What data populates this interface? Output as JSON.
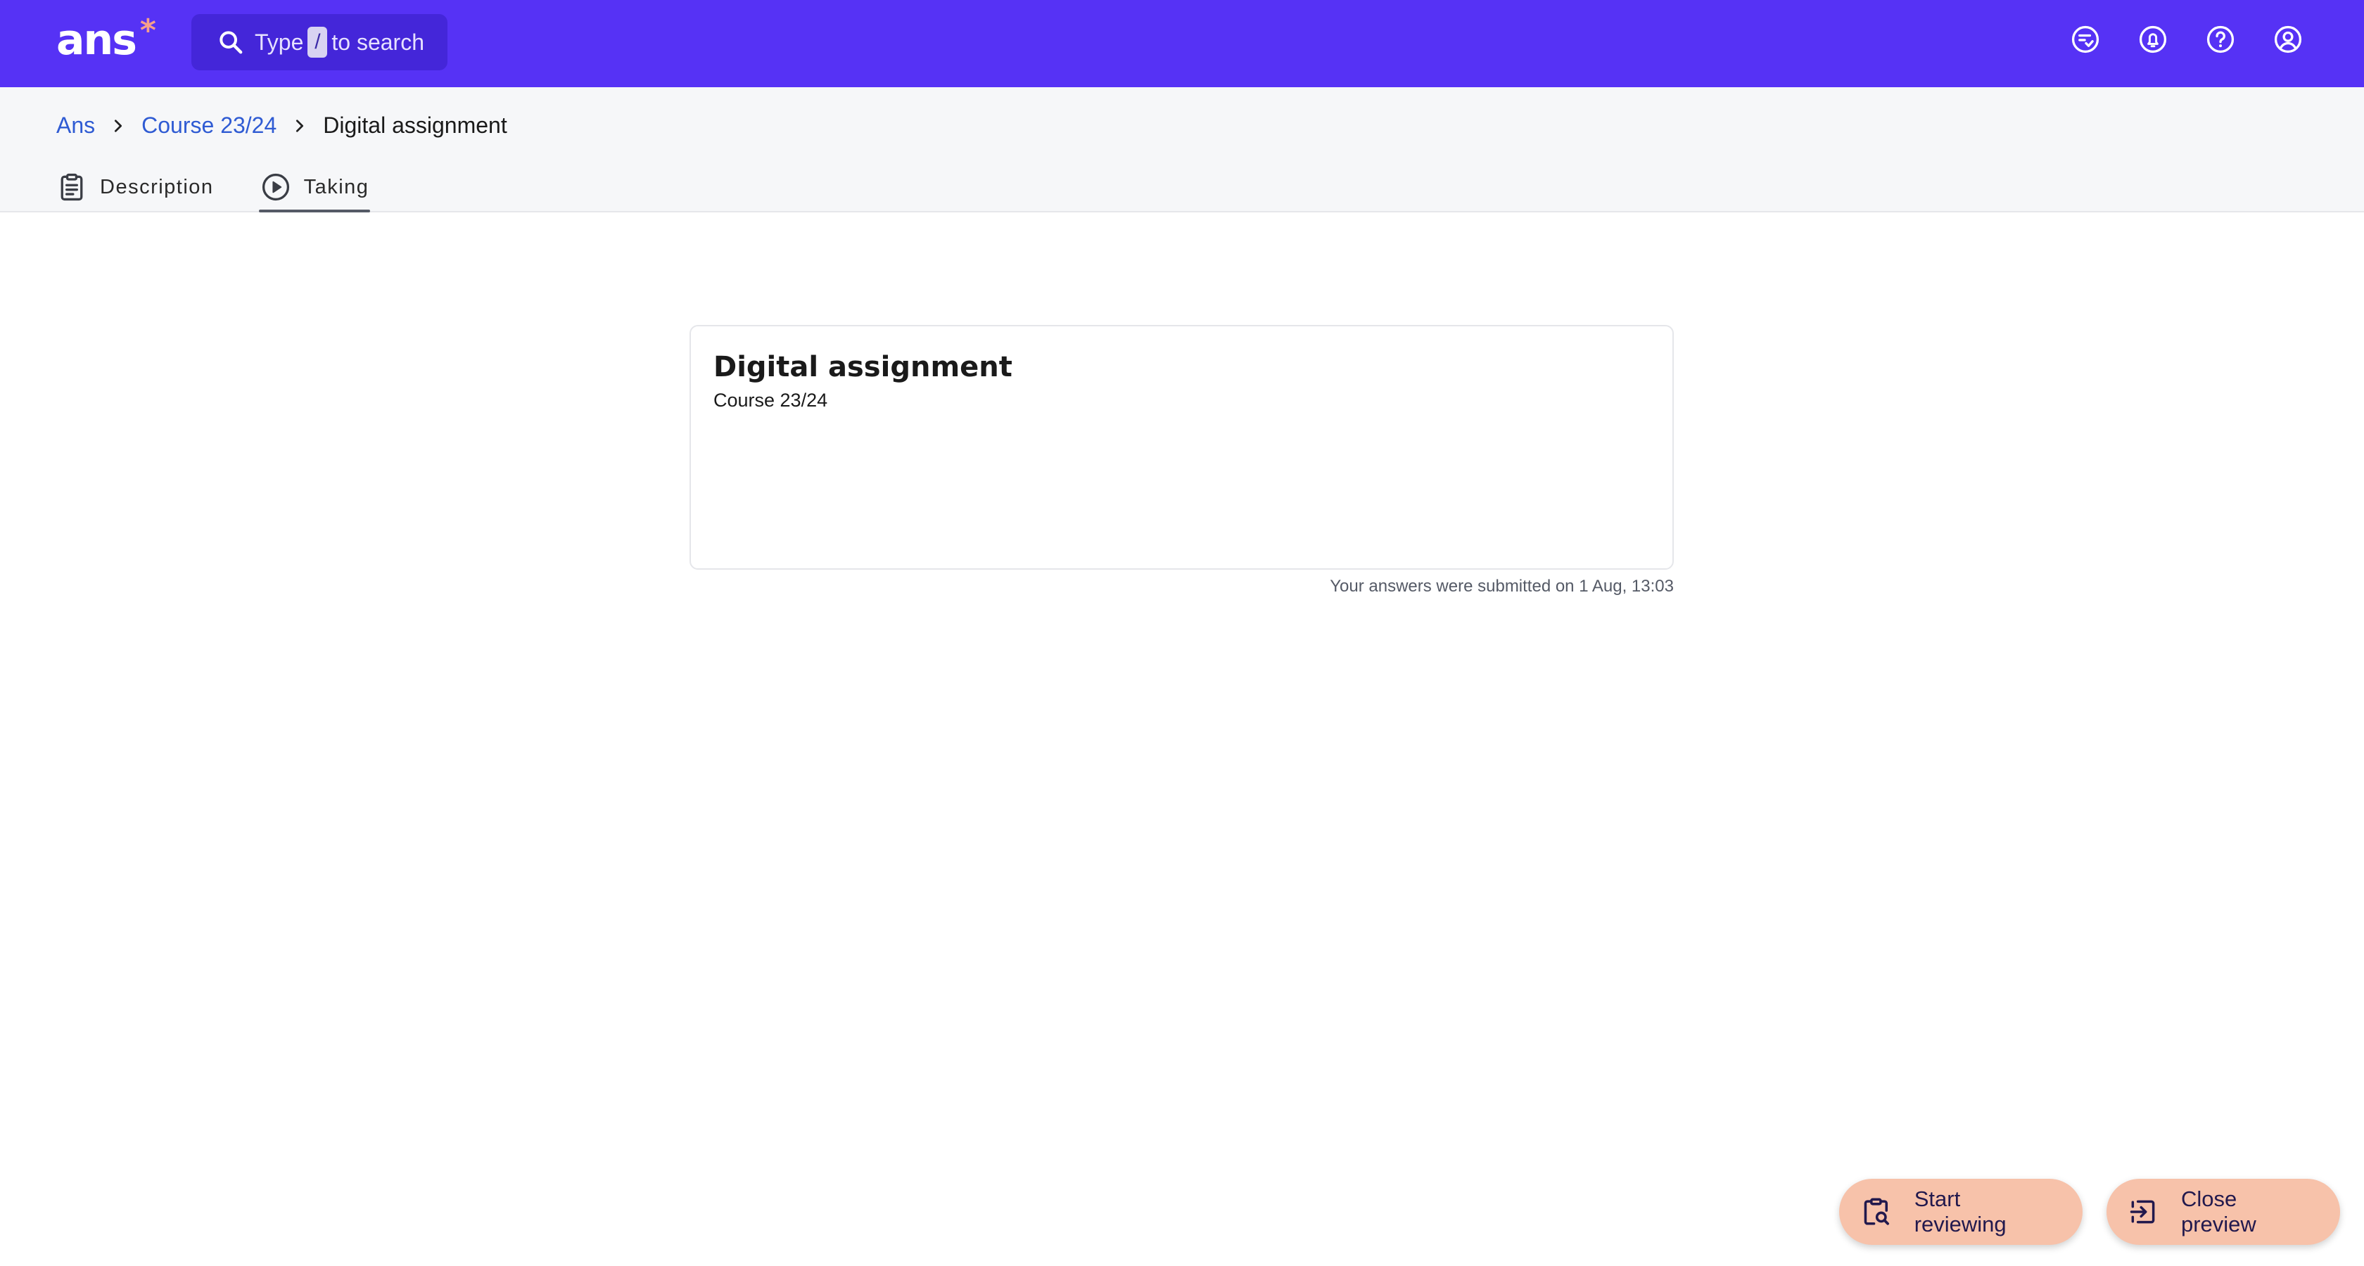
{
  "app": {
    "logo_text": "ans",
    "logo_mark": "*"
  },
  "search": {
    "prefix": "Type",
    "key": "/",
    "suffix": "to search"
  },
  "top_icons": [
    "messages-check-icon",
    "bell-icon",
    "help-icon",
    "account-icon"
  ],
  "breadcrumb": {
    "items": [
      "Ans",
      "Course 23/24"
    ],
    "current": "Digital assignment"
  },
  "tabs": [
    {
      "label": "Description",
      "icon": "clipboard-icon",
      "active": false
    },
    {
      "label": "Taking",
      "icon": "play-circle-icon",
      "active": true
    }
  ],
  "card": {
    "title": "Digital assignment",
    "subtitle": "Course 23/24"
  },
  "submitted_text": "Your answers were submitted on 1 Aug, 13:03",
  "actions": {
    "start_reviewing": "Start reviewing",
    "close_preview": "Close preview"
  },
  "colors": {
    "topbar": "#5632f5",
    "search_bg": "#4426d9",
    "link": "#2f5bd3",
    "fab_bg": "#f7c2aa",
    "logo_mark": "#f7a08a"
  }
}
